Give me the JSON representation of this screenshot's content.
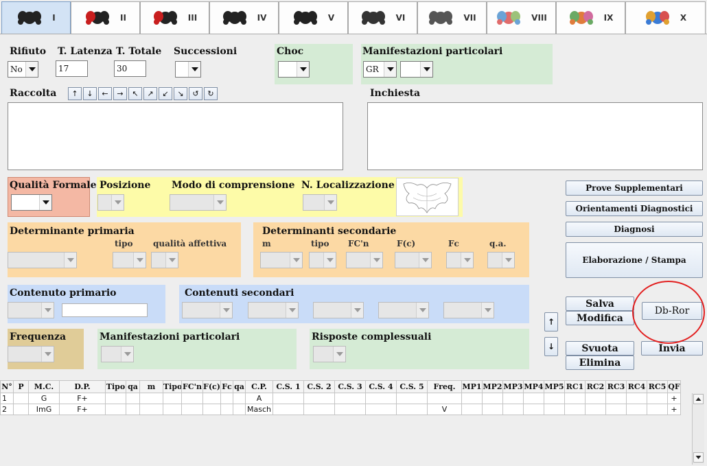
{
  "tabs": [
    {
      "label": "I",
      "icon": "inkblot-card-1-icon",
      "selected": true
    },
    {
      "label": "II",
      "icon": "inkblot-card-2-icon"
    },
    {
      "label": "III",
      "icon": "inkblot-card-3-icon"
    },
    {
      "label": "IV",
      "icon": "inkblot-card-4-icon"
    },
    {
      "label": "V",
      "icon": "inkblot-card-5-icon"
    },
    {
      "label": "VI",
      "icon": "inkblot-card-6-icon"
    },
    {
      "label": "VII",
      "icon": "inkblot-card-7-icon"
    },
    {
      "label": "VIII",
      "icon": "inkblot-card-8-icon"
    },
    {
      "label": "IX",
      "icon": "inkblot-card-9-icon"
    },
    {
      "label": "X",
      "icon": "inkblot-card-10-icon"
    }
  ],
  "top": {
    "rifiuto": {
      "label": "Rifiuto",
      "value": "No"
    },
    "latenza": {
      "label": "T. Latenza",
      "value": "17"
    },
    "totale": {
      "label": "T. Totale",
      "value": "30"
    },
    "successioni": {
      "label": "Successioni",
      "value": ""
    },
    "choc": {
      "label": "Choc",
      "value": ""
    },
    "manifestazioni": {
      "label": "Manifestazioni particolari",
      "value1": "GR",
      "value2": ""
    }
  },
  "raccolta": {
    "label": "Raccolta",
    "buttons": [
      "↑",
      "↓",
      "←",
      "→",
      "↖",
      "↗",
      "↙",
      "↘",
      "↺",
      "↻"
    ],
    "text": ""
  },
  "inchiesta": {
    "label": "Inchiesta",
    "text": ""
  },
  "qualita": {
    "label": "Qualità Formale",
    "value": ""
  },
  "posizione": {
    "label": "Posizione"
  },
  "modo": {
    "label": "Modo di comprensione"
  },
  "localizzazione": {
    "label": "N. Localizzazione"
  },
  "det_primaria": {
    "label": "Determinante primaria",
    "tipo": "tipo",
    "qualita": "qualità affettiva"
  },
  "det_secondarie": {
    "label": "Determinanti secondarie",
    "cols": [
      "m",
      "tipo",
      "FC'n",
      "F(c)",
      "Fc",
      "q.a."
    ]
  },
  "contenuto_primario": {
    "label": "Contenuto primario",
    "text": ""
  },
  "contenuti_secondari": {
    "label": "Contenuti secondari"
  },
  "frequenza": {
    "label": "Frequenza"
  },
  "manifestazioni2": {
    "label": "Manifestazioni particolari"
  },
  "risposte": {
    "label": "Risposte complessuali"
  },
  "side_buttons": {
    "prove": "Prove Supplementari",
    "orientamenti": "Orientamenti Diagnostici",
    "diagnosi": "Diagnosi",
    "elaborazione": "Elaborazione / Stampa"
  },
  "actions": {
    "salva": "Salva",
    "modifica": "Modifica",
    "svuota": "Svuota",
    "elimina": "Elimina",
    "dbror": "Db-Ror",
    "invia": "Invia",
    "up": "↑",
    "down": "↓"
  },
  "colors": {
    "green_panel": "#d5ebd5",
    "yellow_panel": "#fdfba8",
    "orange_panel": "#fcd9a4",
    "blue_panel": "#c9dcf8",
    "tan_panel": "#e0cc98",
    "salmon_panel": "#f4b8a4",
    "highlight_circle": "#e21f1f"
  },
  "table": {
    "columns": [
      "N°",
      "P",
      "M.C.",
      "D.P.",
      "Tipo",
      "qa",
      "m",
      "Tipo",
      "FC'n",
      "F(c)",
      "Fc",
      "qa",
      "C.P.",
      "C.S. 1",
      "C.S. 2",
      "C.S. 3",
      "C.S. 4",
      "C.S. 5",
      "Freq.",
      "MP1",
      "MP2",
      "MP3",
      "MP4",
      "MP5",
      "RC1",
      "RC2",
      "RC3",
      "RC4",
      "RC5",
      "QF"
    ],
    "rows": [
      [
        "1",
        "",
        "G",
        "F+",
        "",
        "",
        "",
        "",
        "",
        "",
        "",
        "",
        "A",
        "",
        "",
        "",
        "",
        "",
        "",
        "",
        "",
        "",
        "",
        "",
        "",
        "",
        "",
        "",
        "",
        "+"
      ],
      [
        "2",
        "",
        "ImG",
        "F+",
        "",
        "",
        "",
        "",
        "",
        "",
        "",
        "",
        "Masch",
        "",
        "",
        "",
        "",
        "",
        "V",
        "",
        "",
        "",
        "",
        "",
        "",
        "",
        "",
        "",
        "",
        "+"
      ]
    ]
  }
}
